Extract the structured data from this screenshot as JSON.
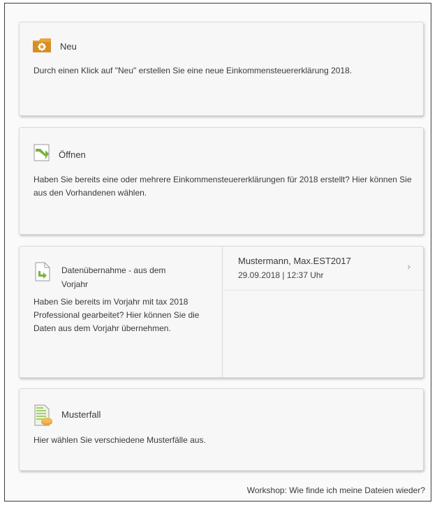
{
  "cards": {
    "new": {
      "title": "Neu",
      "description": "Durch einen Klick auf \"Neu\" erstellen Sie eine neue Einkommensteuererklärung 2018."
    },
    "open": {
      "title": "Öffnen",
      "description": "Haben Sie bereits eine oder mehrere Einkommensteuererklärungen für 2018 erstellt? Hier können Sie aus den Vorhandenen wählen."
    },
    "import": {
      "title": "Datenübernahme - aus dem Vorjahr",
      "description": "Haben Sie bereits im Vorjahr mit tax 2018 Professional gearbeitet? Hier können Sie die Daten aus dem Vorjahr übernehmen.",
      "files": [
        {
          "name": "Mustermann, Max.EST2017",
          "date": "29.09.2018 | 12:37 Uhr"
        }
      ]
    },
    "sample": {
      "title": "Musterfall",
      "description": "Hier wählen Sie verschiedene Musterfälle aus."
    }
  },
  "footer": {
    "link": "Workshop: Wie finde ich meine Dateien wieder?"
  },
  "icons": {
    "new": "folder-new-icon",
    "open": "open-arrow-icon",
    "import": "document-import-icon",
    "sample": "sample-case-icon",
    "chevron": "chevron-right-icon"
  },
  "colors": {
    "folder": "#e8a33a",
    "arrow": "#7cb23a"
  }
}
